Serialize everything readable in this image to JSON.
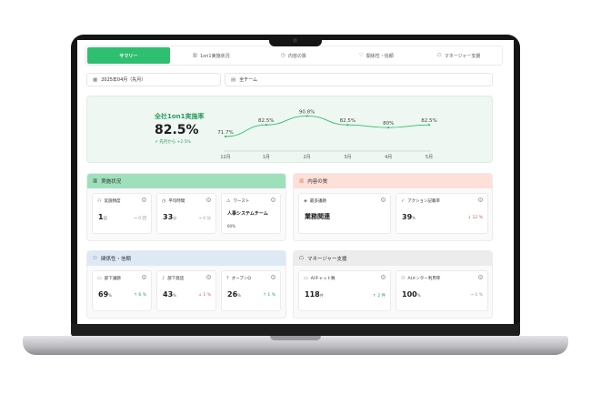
{
  "tabs": [
    {
      "label": "サマリー",
      "icon": "",
      "active": true
    },
    {
      "label": "1on1実施状況",
      "icon": "bar-chart-icon"
    },
    {
      "label": "内容の質",
      "icon": "clock-icon"
    },
    {
      "label": "関係性・信頼",
      "icon": "heart-handshake-icon"
    },
    {
      "label": "マネージャー支援",
      "icon": "robot-icon"
    }
  ],
  "filters": {
    "period": "2025年04月（先月）",
    "team": "全チーム"
  },
  "hero": {
    "title": "全社1on1実施率",
    "value": "82.5%",
    "delta": "↗ 先月から +2.5%"
  },
  "chart_data": {
    "type": "line",
    "categories": [
      "12月",
      "1月",
      "2月",
      "3月",
      "4月",
      "5月"
    ],
    "values": [
      71.7,
      82.5,
      90.8,
      82.5,
      80,
      82.5
    ],
    "labels": [
      "71.7%",
      "82.5%",
      "90.8%",
      "82.5%",
      "80%",
      "82.5%"
    ],
    "color": "#2fbf71"
  },
  "sections": {
    "implementation": {
      "title": "実施状況",
      "header_color": "#9fe0bc",
      "cards": [
        {
          "label": "実施頻度",
          "value": "1",
          "unit": "回",
          "delta": "→ 0 回"
        },
        {
          "label": "平均時間",
          "value": "33",
          "unit": "分",
          "delta": "→ 0 分"
        },
        {
          "label": "ワースト",
          "text": "人事システムチーム",
          "sub": "60%"
        }
      ]
    },
    "quality": {
      "title": "内容の質",
      "header_color": "#fde0d8",
      "cards": [
        {
          "label": "最多議題",
          "text": "業務関連"
        },
        {
          "label": "アクション記載率",
          "value": "39",
          "unit": "%",
          "delta": "↓ 12 %"
        }
      ]
    },
    "relationship": {
      "title": "関係性・信頼",
      "header_color": "#dde9f5",
      "cards": [
        {
          "label": "部下議題",
          "value": "69",
          "unit": "%",
          "delta": "↑ 6 %"
        },
        {
          "label": "部下発話",
          "value": "43",
          "unit": "%",
          "delta": "↓ 1 %"
        },
        {
          "label": "オープンQ",
          "value": "26",
          "unit": "%",
          "delta": "↑ 1 %"
        }
      ]
    },
    "manager": {
      "title": "マネージャー支援",
      "header_color": "#ececec",
      "cards": [
        {
          "label": "AIチャット数",
          "value": "118",
          "unit": "件",
          "delta": "↑ 2 件"
        },
        {
          "label": "AIメンター利用率",
          "value": "100",
          "unit": "%",
          "delta": "→ 0 %"
        }
      ]
    }
  }
}
